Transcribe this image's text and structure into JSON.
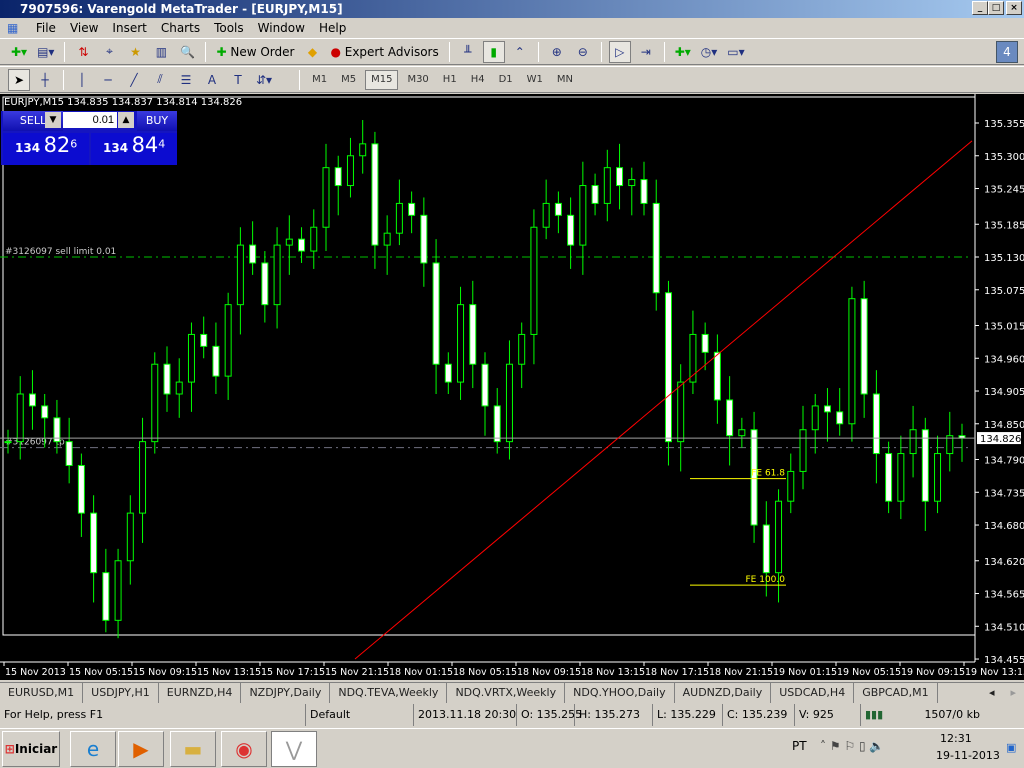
{
  "window": {
    "title": "7907596: Varengold MetaTrader - [EURJPY,M15]"
  },
  "menu": [
    "File",
    "View",
    "Insert",
    "Charts",
    "Tools",
    "Window",
    "Help"
  ],
  "toolbar": {
    "new_order": "New Order",
    "expert_advisors": "Expert Advisors",
    "notification_count": "4"
  },
  "timeframes": [
    "M1",
    "M5",
    "M15",
    "M30",
    "H1",
    "H4",
    "D1",
    "W1",
    "MN"
  ],
  "active_timeframe": "M15",
  "chart_header": "EURJPY,M15  134.835 134.837 134.814 134.826",
  "trade_panel": {
    "sell": "SELL",
    "buy": "BUY",
    "lot": "0.01",
    "bid_big": "134",
    "bid_main": "82",
    "bid_small": "6",
    "ask_big": "134",
    "ask_main": "84",
    "ask_small": "4"
  },
  "chart_data": {
    "type": "candlestick",
    "symbol": "EURJPY",
    "timeframe": "M15",
    "ylim": [
      134.455,
      135.385
    ],
    "y_ticks": [
      "135.355",
      "135.300",
      "135.245",
      "135.185",
      "135.130",
      "135.075",
      "135.015",
      "134.960",
      "134.905",
      "134.850",
      "134.790",
      "134.735",
      "134.680",
      "134.620",
      "134.565",
      "134.510",
      "134.455"
    ],
    "x_ticks": [
      "15 Nov 2013",
      "15 Nov 05:15",
      "15 Nov 09:15",
      "15 Nov 13:15",
      "15 Nov 17:15",
      "15 Nov 21:15",
      "18 Nov 01:15",
      "18 Nov 05:15",
      "18 Nov 09:15",
      "18 Nov 13:15",
      "18 Nov 17:15",
      "18 Nov 21:15",
      "19 Nov 01:15",
      "19 Nov 05:15",
      "19 Nov 09:15",
      "19 Nov 13:15"
    ],
    "closes": [
      134.82,
      134.9,
      134.88,
      134.86,
      134.82,
      134.78,
      134.7,
      134.6,
      134.52,
      134.62,
      134.7,
      134.82,
      134.95,
      134.9,
      134.92,
      135.0,
      134.98,
      134.93,
      135.05,
      135.15,
      135.12,
      135.05,
      135.15,
      135.16,
      135.14,
      135.18,
      135.28,
      135.25,
      135.3,
      135.32,
      135.15,
      135.17,
      135.22,
      135.2,
      135.12,
      134.95,
      134.92,
      135.05,
      134.95,
      134.88,
      134.82,
      134.95,
      135.0,
      135.18,
      135.22,
      135.2,
      135.15,
      135.25,
      135.22,
      135.28,
      135.25,
      135.26,
      135.22,
      135.07,
      134.82,
      134.92,
      135.0,
      134.97,
      134.89,
      134.83,
      134.84,
      134.68,
      134.6,
      134.72,
      134.77,
      134.84,
      134.88,
      134.87,
      134.85,
      135.06,
      134.9,
      134.8,
      134.72,
      134.8,
      134.84,
      134.72,
      134.8,
      134.83,
      134.826
    ],
    "current_price": "134.826",
    "orders": [
      {
        "label": "#3126097 sell limit 0.01",
        "price": 135.13
      },
      {
        "label": "#3126097 tp",
        "price": 134.81
      }
    ],
    "fibo_labels": [
      {
        "label": "FE 61.8",
        "price": 134.758
      },
      {
        "label": "FE 100.0",
        "price": 134.579
      }
    ],
    "trendline": {
      "from": [
        "15 Nov 21:15",
        134.455
      ],
      "to": [
        "19 Nov 13:15",
        135.325
      ]
    },
    "colors": {
      "candle": "#00ff00",
      "bg": "#000000",
      "order": "#00c000",
      "trend": "#ff0000",
      "fibo": "#ffff00"
    }
  },
  "tabs": [
    "EURUSD,M1",
    "USDJPY,H1",
    "EURNZD,H4",
    "NZDJPY,Daily",
    "NDQ.TEVA,Weekly",
    "NDQ.VRTX,Weekly",
    "NDQ.YHOO,Daily",
    "AUDNZD,Daily",
    "USDCAD,H4",
    "GBPCAD,M1"
  ],
  "status": {
    "help": "For Help, press F1",
    "profile": "Default",
    "time": "2013.11.18 20:30",
    "open": "O: 135.255",
    "high": "H: 135.273",
    "low": "L: 135.229",
    "close": "C: 135.239",
    "volume": "V: 925",
    "traffic": "1507/0 kb"
  },
  "taskbar": {
    "start": "Iniciar",
    "lang": "PT",
    "clock_time": "12:31",
    "clock_date": "19-11-2013"
  }
}
